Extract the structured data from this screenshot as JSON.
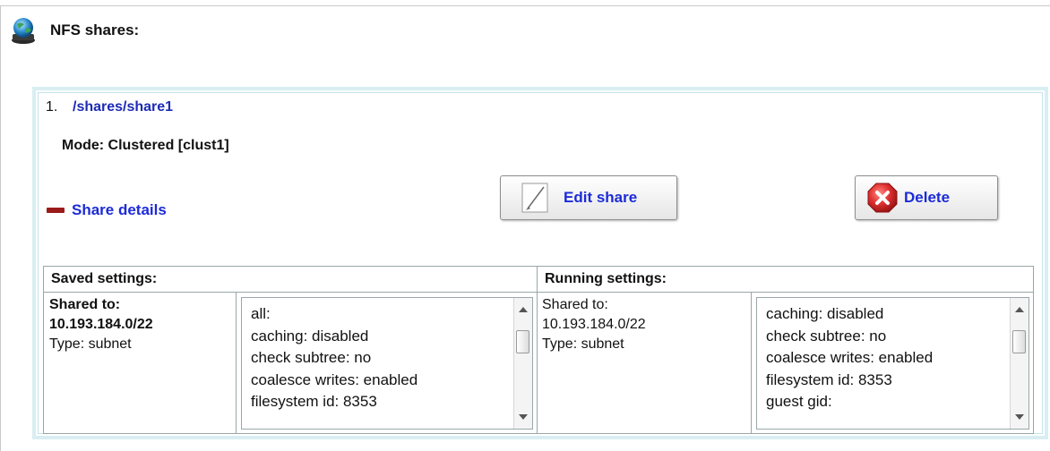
{
  "header": {
    "title": "NFS shares:",
    "icon": "globe-server-icon"
  },
  "share": {
    "number": "1.",
    "path": "/shares/share1",
    "mode": "Mode: Clustered [clust1]",
    "details_toggle": "Share details",
    "details_toggle_icon": "minus-icon",
    "edit_button": {
      "label": "Edit share",
      "icon": "pencil-icon"
    },
    "delete_button": {
      "label": "Delete",
      "icon": "delete-x-icon",
      "icon_color": "#d6262a"
    }
  },
  "saved": {
    "heading": "Saved settings:",
    "shared_to_label": "Shared to:",
    "shared_to_value": "10.193.184.0/22",
    "type": "Type: subnet",
    "options": [
      "all:",
      "caching: disabled",
      "check subtree: no",
      "coalesce writes: enabled",
      "filesystem id: 8353"
    ]
  },
  "running": {
    "heading": "Running settings:",
    "shared_to_label": "Shared to:",
    "shared_to_value": "10.193.184.0/22",
    "type": "Type: subnet",
    "options": [
      "caching: disabled",
      "check subtree: no",
      "coalesce writes: enabled",
      "filesystem id: 8353",
      "guest gid:"
    ]
  },
  "colors": {
    "link_blue": "#1c2bd8",
    "path_blue": "#1c2bb5",
    "panel_border": "#d9eef2",
    "toggle_red": "#9b1b1b"
  }
}
